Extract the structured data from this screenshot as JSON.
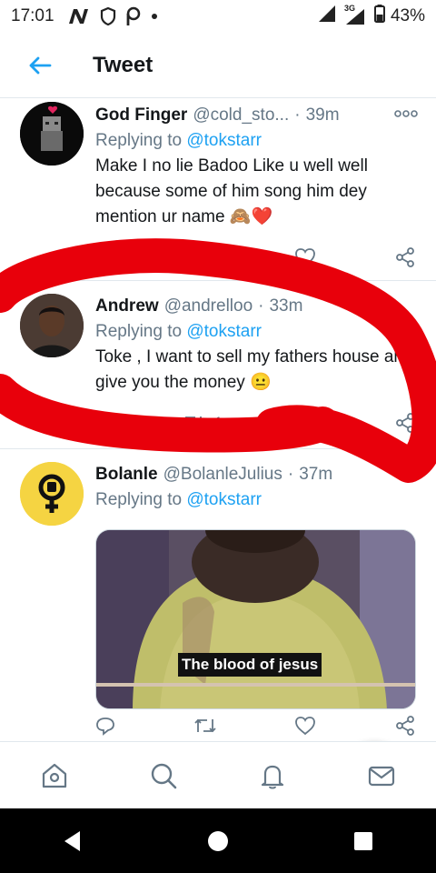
{
  "status_bar": {
    "time": "17:01",
    "network": "3G",
    "battery": "43%"
  },
  "header": {
    "title": "Tweet"
  },
  "tweets": [
    {
      "name": "God Finger",
      "handle": "@cold_sto...",
      "time": "39m",
      "replying_prefix": "Replying to ",
      "replying_to": "@tokstarr",
      "text": "Make I no lie Badoo Like u well well because some of him song him dey mention ur name 🙈❤️"
    },
    {
      "name": "Andrew",
      "handle": "@andrelloo",
      "time": "33m",
      "replying_prefix": "Replying to ",
      "replying_to": "@tokstarr",
      "text": "Toke , I want to sell my fathers house and give you the money 😐",
      "retweets": "1",
      "likes": "1"
    },
    {
      "name": "Bolanle",
      "handle": "@BolanleJulius",
      "time": "37m",
      "replying_prefix": "Replying to ",
      "replying_to": "@tokstarr",
      "media_caption": "The blood of jesus"
    }
  ],
  "colors": {
    "accent": "#1da1f2",
    "secondary_text": "#657786",
    "annotation_red": "#e8000b",
    "like_red": "#e0245e"
  },
  "icons": [
    "back-arrow-icon",
    "home-icon",
    "search-icon",
    "notifications-icon",
    "messages-icon",
    "compose-reply-icon",
    "reply-icon",
    "retweet-icon",
    "like-icon",
    "share-icon",
    "more-icon"
  ]
}
